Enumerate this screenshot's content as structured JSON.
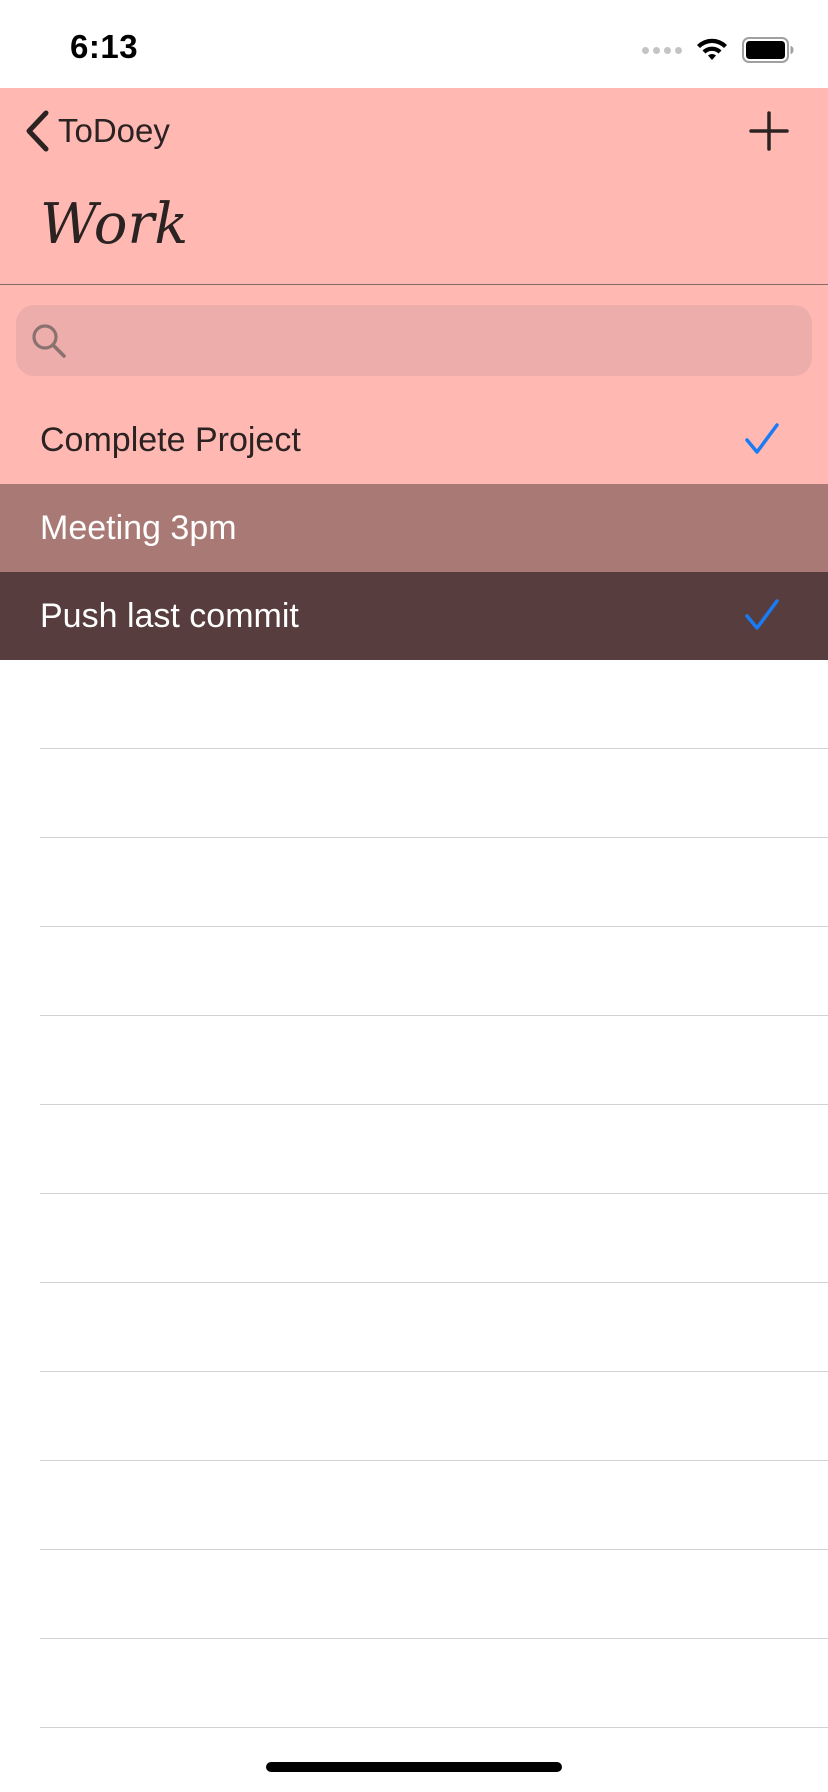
{
  "status_bar": {
    "time": "6:13"
  },
  "nav": {
    "back_label": "ToDoey",
    "title": "Work",
    "background_color": "#ffb8b2",
    "tint_color": "#2b2222"
  },
  "search": {
    "placeholder": "",
    "value": ""
  },
  "items": [
    {
      "title": "Complete Project",
      "done": true,
      "background": "#ffb8b2",
      "text_color": "#2b2222"
    },
    {
      "title": "Meeting 3pm",
      "done": false,
      "background": "#a97a75",
      "text_color": "#ffffff"
    },
    {
      "title": "Push last commit",
      "done": true,
      "background": "#573d3d",
      "text_color": "#ffffff"
    }
  ],
  "check_color": "#1a7cf5",
  "icons": {
    "back": "chevron-left-icon",
    "add": "plus-icon",
    "search": "search-icon",
    "check": "checkmark-icon",
    "wifi": "wifi-icon",
    "battery": "battery-icon"
  }
}
